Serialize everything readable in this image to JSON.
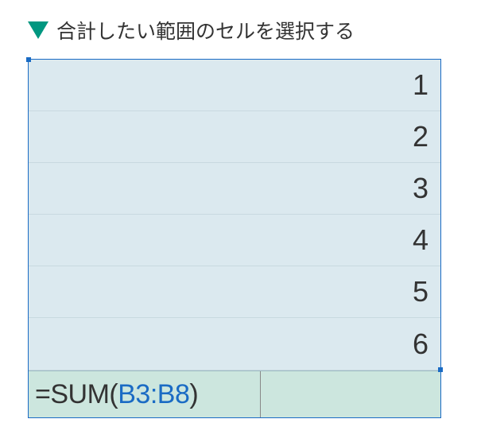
{
  "header": {
    "title": "合計したい範囲のセルを選択する"
  },
  "cells": {
    "row1": "1",
    "row2": "2",
    "row3": "3",
    "row4": "4",
    "row5": "5",
    "row6": "6"
  },
  "formula": {
    "prefix": "=SUM(",
    "range": "B3:B8",
    "suffix": ")"
  }
}
